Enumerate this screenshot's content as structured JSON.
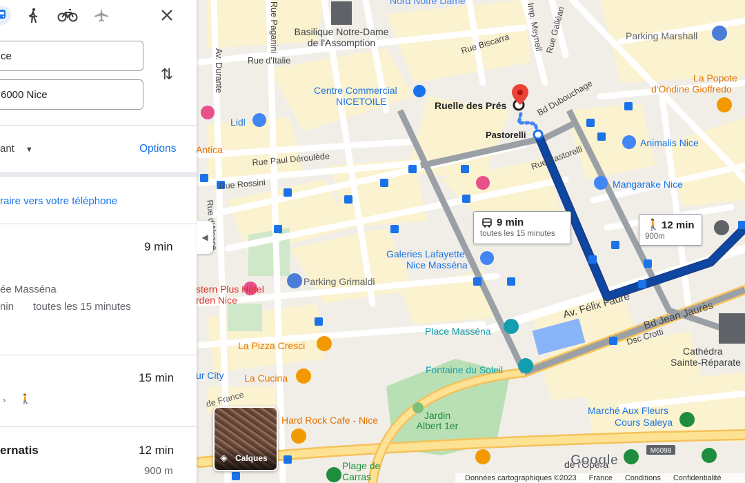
{
  "panel": {
    "modes": [
      {
        "name": "transit-mode-icon",
        "active": true
      },
      {
        "name": "walk-mode-icon"
      },
      {
        "name": "bike-mode-icon"
      },
      {
        "name": "flight-mode-icon"
      }
    ],
    "origin_value": "ce",
    "destination_value": "6000 Nice",
    "depart_label": "ant",
    "options_label": "Options",
    "send_label": "raire vers votre téléphone",
    "routes": [
      {
        "duration": "9 min",
        "line1": "ée Masséna",
        "line2a": "nin",
        "line2b": "toutes les 15 minutes"
      },
      {
        "duration": "15 min"
      },
      {
        "title": "ernatis",
        "duration": "12 min",
        "distance": "900 m"
      }
    ]
  },
  "map": {
    "labels": {
      "notre_dame": "Basilique Notre-Dame",
      "notre_dame_2": "de l'Assomption",
      "nord_notre_dame": "Nord Notre Dame",
      "parking_marshall": "Parking Marshall",
      "la_popote_1": "La Popote",
      "la_popote_2": "d'Ondine Gioffredo",
      "centre_commercial": "Centre Commercial",
      "nicetoile": "NICETOILE",
      "ruelle": "Ruelle des Prés",
      "pastorelli": "Pastorelli",
      "lidl": "Lidl",
      "antica": "Antica",
      "animalis": "Animalis Nice",
      "mangarake": "Mangarake Nice",
      "galeries_1": "Galeries Lafayette",
      "galeries_2": "Nice Masséna",
      "parking_grimaldi": "Parking Grimaldi",
      "best_western_1": "stern Plus Hôtel",
      "best_western_2": "rden Nice",
      "place_massena": "Place Masséna",
      "pizza_cresci": "La Pizza Cresci",
      "la_cucina": "La Cucina",
      "fontaine": "Fontaine du Soleil",
      "hard_rock": "Hard Rock Cafe - Nice",
      "jardin_1": "Jardin",
      "jardin_2": "Albert 1er",
      "marche_1": "Marché Aux Fleurs",
      "marche_2": "Cours Saleya",
      "plage_1": "Plage de",
      "plage_2": "Carras",
      "opera": "de l'Opéra",
      "cathedrale_1": "Cathédra",
      "cathedrale_2": "Sainte-Réparate",
      "ur_city": "ur City",
      "de_france": "de France",
      "m6098": "M6098"
    },
    "streets": {
      "paganini": "Rue Paganini",
      "italie": "Rue d'Italie",
      "durante": "Av. Durante",
      "biscarra": "Rue Biscarra",
      "meynell": "Imp. Meynell",
      "gallean": "Rue Galléan",
      "dubouchage": "Bd Dubouchage",
      "pastorelli_st": "Rue Pastorelli",
      "deroulede": "Rue Paul Déroulède",
      "rossini": "Rue Rossini",
      "alsace": "Rue d'Alsace",
      "felix_faure": "Av. Félix Faure",
      "jean_jaures": "Bd Jean Jaurès",
      "crotti": "Dsc Crotti"
    },
    "callout_transit": {
      "duration": "9 min",
      "frequency": "toutes les 15 minutes"
    },
    "callout_walk": {
      "duration": "12 min",
      "distance": "900m"
    },
    "layers_label": "Calques",
    "attribution": [
      "Données cartographiques ©2023",
      "France",
      "Conditions",
      "Confidentialité"
    ],
    "google_logo": "Google"
  }
}
